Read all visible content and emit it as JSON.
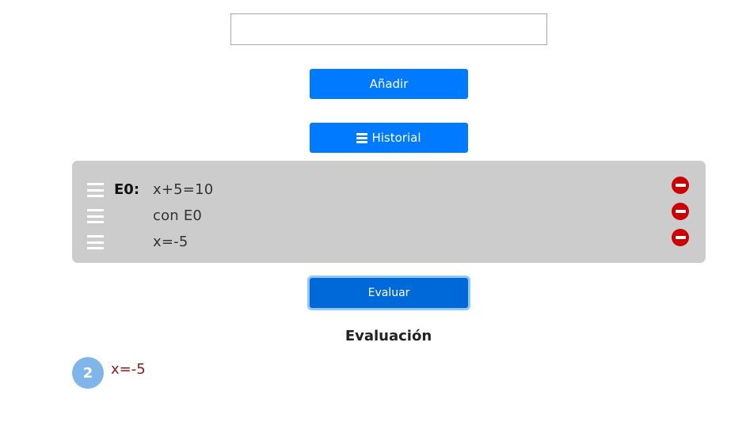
{
  "input": {
    "value": "",
    "placeholder": ""
  },
  "buttons": {
    "add_label": "Añadir",
    "history_label": "Historial",
    "evaluate_label": "Evaluar"
  },
  "history": {
    "rows": [
      {
        "label": "E0:",
        "text": "x+5=10"
      },
      {
        "label": "",
        "text": "con E0"
      },
      {
        "label": "",
        "text": "x=-5"
      }
    ]
  },
  "evaluation": {
    "heading": "Evaluación",
    "badge": "2",
    "result": "x=-5"
  },
  "colors": {
    "primary": "#007bff",
    "primary_active": "#0069d9",
    "panel_bg": "#cccccc",
    "remove_red": "#cc0000",
    "badge_blue": "#7fb5e8",
    "result_text": "#8b1a1a"
  },
  "icons": {
    "history_button_icon": "bars-icon",
    "row_handle_icon": "bars-icon",
    "row_remove_icon": "minus-circle-icon"
  }
}
